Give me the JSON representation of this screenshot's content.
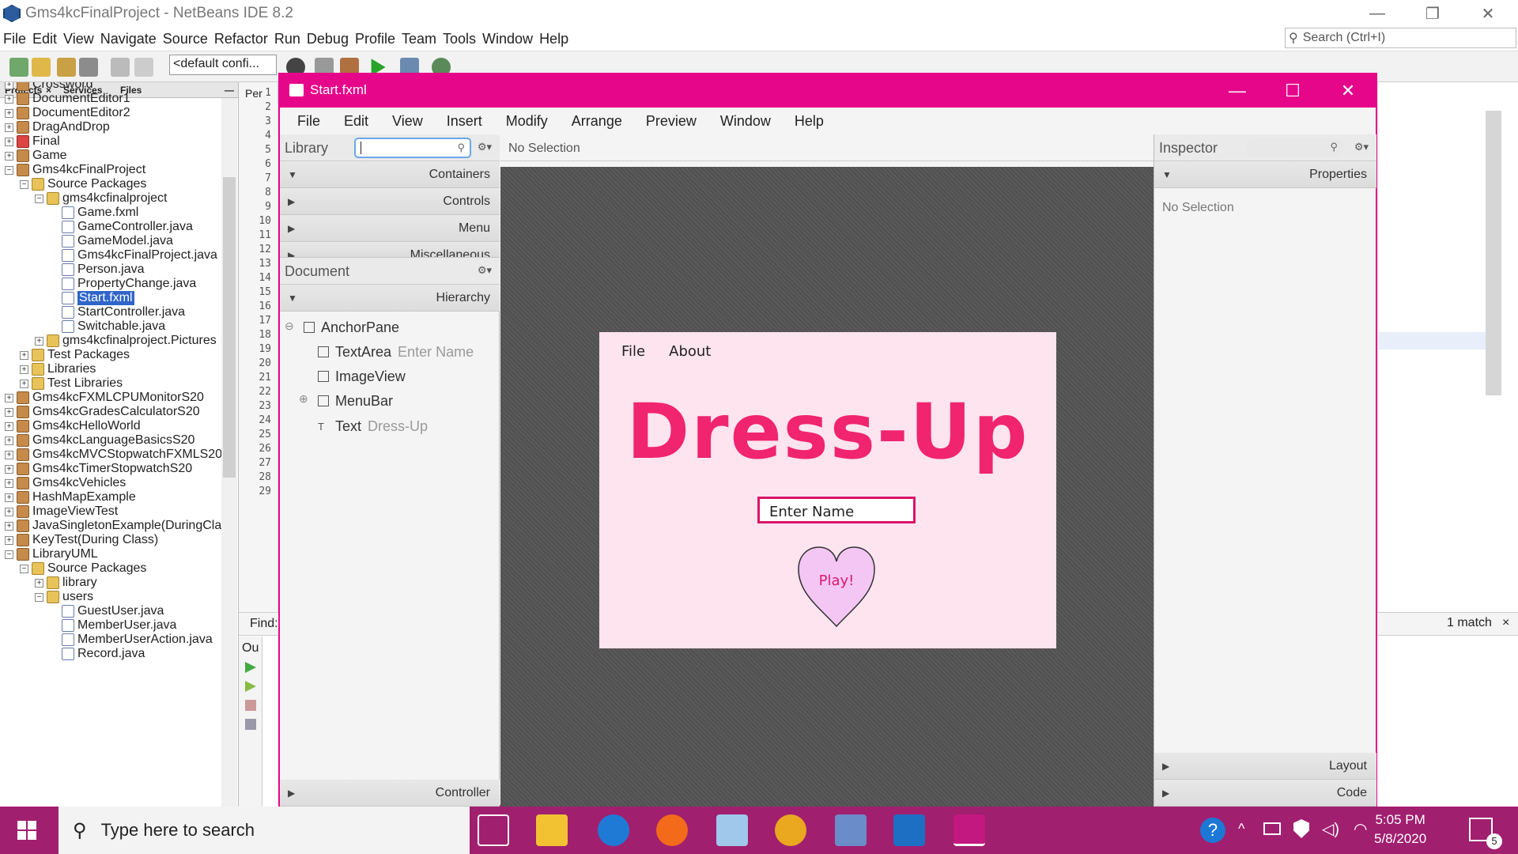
{
  "netbeans": {
    "title": "Gms4kcFinalProject - NetBeans IDE 8.2",
    "menu": [
      "File",
      "Edit",
      "View",
      "Navigate",
      "Source",
      "Refactor",
      "Run",
      "Debug",
      "Profile",
      "Team",
      "Tools",
      "Window",
      "Help"
    ],
    "search_placeholder": "Search (Ctrl+I)",
    "config": "<default confi...",
    "tabs": [
      "Projects",
      "Services",
      "Files"
    ],
    "tree": [
      {
        "label": "Crossword",
        "level": 0,
        "icon": "project"
      },
      {
        "label": "DocumentEditor1",
        "level": 0,
        "icon": "project"
      },
      {
        "label": "DocumentEditor2",
        "level": 0,
        "icon": "project"
      },
      {
        "label": "DragAndDrop",
        "level": 0,
        "icon": "project"
      },
      {
        "label": "Final",
        "level": 0,
        "icon": "project-red"
      },
      {
        "label": "Game",
        "level": 0,
        "icon": "project"
      },
      {
        "label": "Gms4kcFinalProject",
        "level": 0,
        "icon": "project",
        "expanded": true
      },
      {
        "label": "Source Packages",
        "level": 1,
        "icon": "package",
        "expanded": true
      },
      {
        "label": "gms4kcfinalproject",
        "level": 2,
        "icon": "package",
        "expanded": true
      },
      {
        "label": "Game.fxml",
        "level": 3,
        "icon": "file"
      },
      {
        "label": "GameController.java",
        "level": 3,
        "icon": "file"
      },
      {
        "label": "GameModel.java",
        "level": 3,
        "icon": "file"
      },
      {
        "label": "Gms4kcFinalProject.java",
        "level": 3,
        "icon": "file"
      },
      {
        "label": "Person.java",
        "level": 3,
        "icon": "file"
      },
      {
        "label": "PropertyChange.java",
        "level": 3,
        "icon": "file"
      },
      {
        "label": "Start.fxml",
        "level": 3,
        "icon": "file",
        "selected": true
      },
      {
        "label": "StartController.java",
        "level": 3,
        "icon": "file"
      },
      {
        "label": "Switchable.java",
        "level": 3,
        "icon": "file"
      },
      {
        "label": "gms4kcfinalproject.Pictures",
        "level": 2,
        "icon": "package"
      },
      {
        "label": "Test Packages",
        "level": 1,
        "icon": "package"
      },
      {
        "label": "Libraries",
        "level": 1,
        "icon": "package"
      },
      {
        "label": "Test Libraries",
        "level": 1,
        "icon": "package"
      },
      {
        "label": "Gms4kcFXMLCPUMonitorS20",
        "level": 0,
        "icon": "project"
      },
      {
        "label": "Gms4kcGradesCalculatorS20",
        "level": 0,
        "icon": "project"
      },
      {
        "label": "Gms4kcHelloWorld",
        "level": 0,
        "icon": "project"
      },
      {
        "label": "Gms4kcLanguageBasicsS20",
        "level": 0,
        "icon": "project"
      },
      {
        "label": "Gms4kcMVCStopwatchFXMLS20",
        "level": 0,
        "icon": "project"
      },
      {
        "label": "Gms4kcTimerStopwatchS20",
        "level": 0,
        "icon": "project"
      },
      {
        "label": "Gms4kcVehicles",
        "level": 0,
        "icon": "project"
      },
      {
        "label": "HashMapExample",
        "level": 0,
        "icon": "project"
      },
      {
        "label": "ImageViewTest",
        "level": 0,
        "icon": "project"
      },
      {
        "label": "JavaSingletonExample(DuringCla",
        "level": 0,
        "icon": "project"
      },
      {
        "label": "KeyTest(During Class)",
        "level": 0,
        "icon": "project"
      },
      {
        "label": "LibraryUML",
        "level": 0,
        "icon": "project",
        "expanded": true
      },
      {
        "label": "Source Packages",
        "level": 1,
        "icon": "package",
        "expanded": true
      },
      {
        "label": "library",
        "level": 2,
        "icon": "package"
      },
      {
        "label": "users",
        "level": 2,
        "icon": "package",
        "expanded": true
      },
      {
        "label": "GuestUser.java",
        "level": 3,
        "icon": "file"
      },
      {
        "label": "MemberUser.java",
        "level": 3,
        "icon": "file"
      },
      {
        "label": "MemberUserAction.java",
        "level": 3,
        "icon": "file"
      },
      {
        "label": "Record.java",
        "level": 3,
        "icon": "file"
      }
    ],
    "line_numbers": [
      "1",
      "2",
      "3",
      "4",
      "5",
      "6",
      "7",
      "8",
      "9",
      "10",
      "11",
      "12",
      "13",
      "14",
      "15",
      "16",
      "17",
      "18",
      "19",
      "20",
      "21",
      "22",
      "23",
      "24",
      "25",
      "26",
      "27",
      "28",
      "29"
    ],
    "editor_tab": "Per",
    "find_label": "Find:",
    "match_count": "1 match",
    "output_tab": "Ou"
  },
  "scenebuilder": {
    "title": "Start.fxml",
    "menu": [
      "File",
      "Edit",
      "View",
      "Insert",
      "Modify",
      "Arrange",
      "Preview",
      "Window",
      "Help"
    ],
    "library_label": "Library",
    "library_sections": [
      "Containers",
      "Controls",
      "Menu",
      "Miscellaneous"
    ],
    "document_label": "Document",
    "hierarchy_label": "Hierarchy",
    "hierarchy": [
      {
        "type": "AnchorPane",
        "detail": ""
      },
      {
        "type": "TextArea",
        "detail": "Enter Name"
      },
      {
        "type": "ImageView",
        "detail": ""
      },
      {
        "type": "MenuBar",
        "detail": ""
      },
      {
        "type": "Text",
        "detail": "Dress-Up"
      }
    ],
    "controller_label": "Controller",
    "breadcrumb": "No Selection",
    "inspector_label": "Inspector",
    "properties_label": "Properties",
    "inspector_empty": "No Selection",
    "layout_label": "Layout",
    "code_label": "Code",
    "stage": {
      "menu": [
        "File",
        "About"
      ],
      "title": "Dress-Up",
      "input_value": "Enter Name",
      "button_label": "Play!"
    }
  },
  "taskbar": {
    "search_placeholder": "Type here to search",
    "time": "5:05 PM",
    "date": "5/8/2020",
    "notification_count": "5"
  },
  "colors": {
    "sb_accent": "#e6068a",
    "taskbar": "#a11f6f",
    "stage_bg": "#fde4ef",
    "title_pink": "#f0246f",
    "heart_fill": "#f4c6f4"
  }
}
